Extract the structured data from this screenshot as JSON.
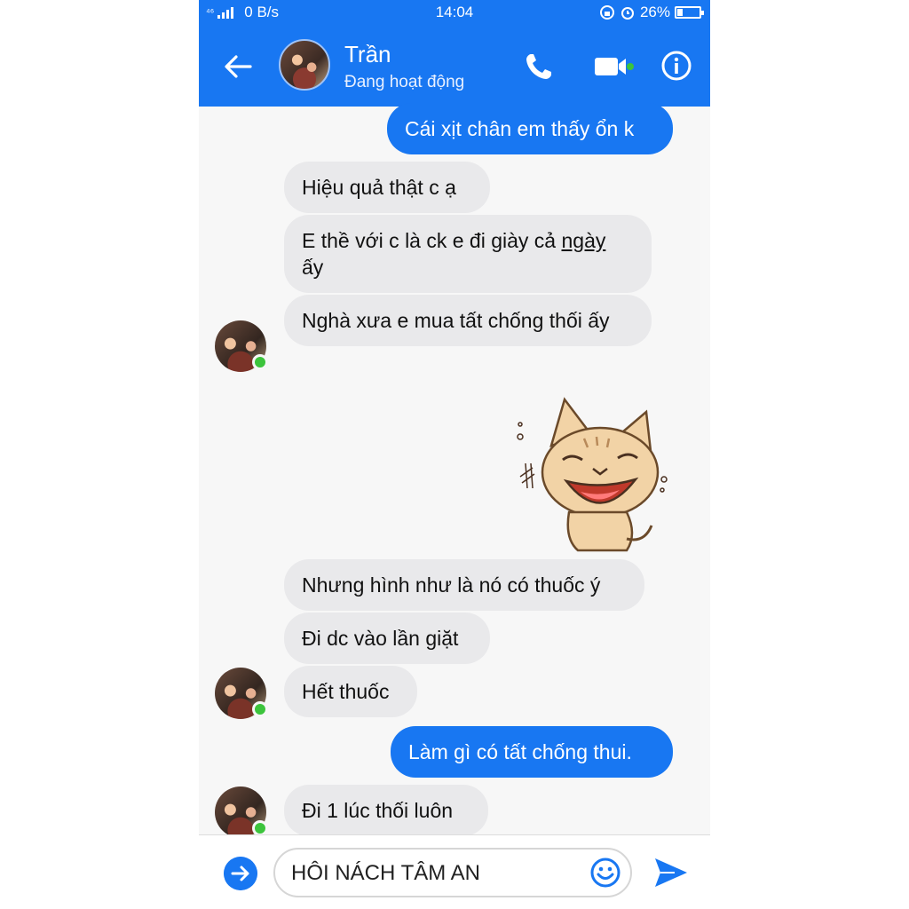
{
  "status_bar": {
    "network_label": "⁴⁶",
    "speed": "0 B/s",
    "time": "14:04",
    "battery_percent": "26%",
    "battery_level": 0.26
  },
  "header": {
    "name": "Trần",
    "status": "Đang hoạt động",
    "accent_color": "#1877f2"
  },
  "messages": {
    "m1": "Cái xịt chân em thấy ổn k",
    "m2": "Hiệu quả thật c ạ",
    "m3_part1": "E thề với c là ck e đi giày cả ",
    "m3_underlined": "ngày",
    "m3_part2": "ấy",
    "m4": "Nghà xưa e mua tất chống thối ấy",
    "m5": "Nhưng hình như là nó có thuốc ý",
    "m6": "Đi dc vào lần giặt",
    "m7": "Hết thuốc",
    "m8": "Làm gì có tất chống thui.",
    "m9": "Đi 1 lúc thối luôn"
  },
  "sticker": {
    "icon": "laughing-cat-sticker"
  },
  "composer": {
    "input_value": "HÔI NÁCH TÂM AN",
    "plus_icon": "plus-icon",
    "emoji_icon": "emoji-icon",
    "send_icon": "send-icon"
  }
}
